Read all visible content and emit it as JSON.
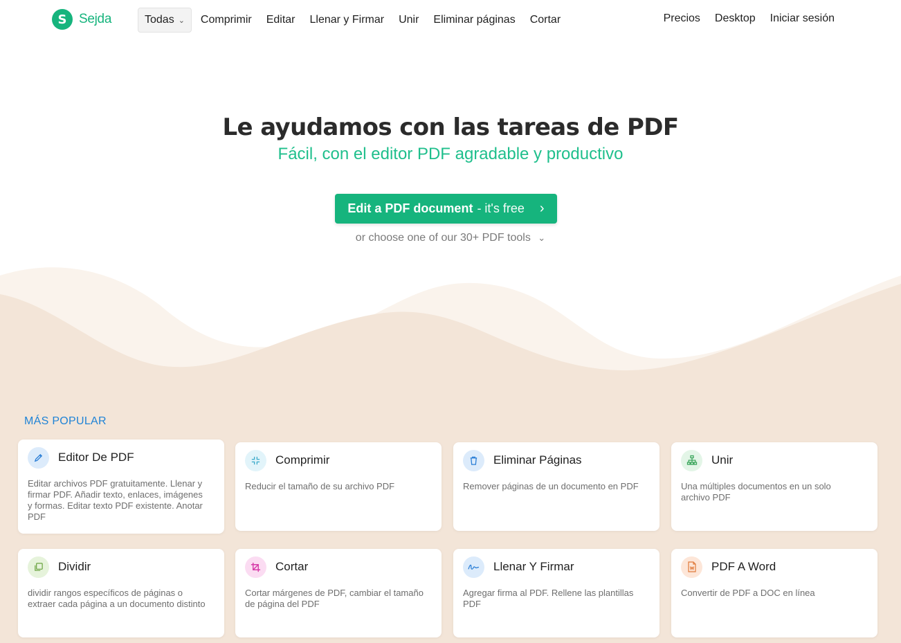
{
  "brand": {
    "name": "Sejda",
    "mark": "S",
    "color": "#16b47d"
  },
  "nav": {
    "todas": "Todas",
    "links": [
      "Comprimir",
      "Editar",
      "Llenar y Firmar",
      "Unir",
      "Eliminar páginas",
      "Cortar"
    ],
    "right": [
      "Precios",
      "Desktop",
      "Iniciar sesión"
    ]
  },
  "hero": {
    "title": "Le ayudamos con las tareas de PDF",
    "subtitle": "Fácil, con el editor PDF agradable y productivo",
    "cta_bold": "Edit a PDF document",
    "cta_light": "- it's free",
    "choose": "or choose one of our 30+ PDF tools"
  },
  "section_label": "MÁS POPULAR",
  "cards": [
    {
      "title": "Editor De PDF",
      "desc": "Editar archivos PDF gratuitamente. Llenar y firmar PDF. Añadir texto, enlaces, imágenes y formas. Editar texto PDF existente. Anotar PDF",
      "icon": "pencil-icon",
      "icon_bg": "#dcebfb",
      "icon_color": "#2c7fd6"
    },
    {
      "title": "Comprimir",
      "desc": "Reducir el tamaño de su archivo PDF",
      "icon": "compress-icon",
      "icon_bg": "#e2f4fa",
      "icon_color": "#3aa9c9"
    },
    {
      "title": "Eliminar Páginas",
      "desc": "Remover páginas de un documento en PDF",
      "icon": "trash-icon",
      "icon_bg": "#dcebfb",
      "icon_color": "#2c7fd6"
    },
    {
      "title": "Unir",
      "desc": "Una múltiples documentos en un solo archivo PDF",
      "icon": "merge-icon",
      "icon_bg": "#e3f5e7",
      "icon_color": "#3aa55a"
    },
    {
      "title": "Dividir",
      "desc": "dividir rangos específicos de páginas o extraer cada página a un documento distinto",
      "icon": "split-icon",
      "icon_bg": "#e6f3db",
      "icon_color": "#6aa341"
    },
    {
      "title": "Cortar",
      "desc": "Cortar márgenes de PDF, cambiar el tamaño de página del PDF",
      "icon": "crop-icon",
      "icon_bg": "#fbdcf2",
      "icon_color": "#d63aa8"
    },
    {
      "title": "Llenar Y Firmar",
      "desc": "Agregar firma al PDF. Rellene las plantillas PDF",
      "icon": "signature-icon",
      "icon_bg": "#dcebfb",
      "icon_color": "#2c7fd6"
    },
    {
      "title": "PDF A Word",
      "desc": "Convertir de PDF a DOC en línea",
      "icon": "word-file-icon",
      "icon_bg": "#fde6d8",
      "icon_color": "#e07a3a"
    }
  ]
}
